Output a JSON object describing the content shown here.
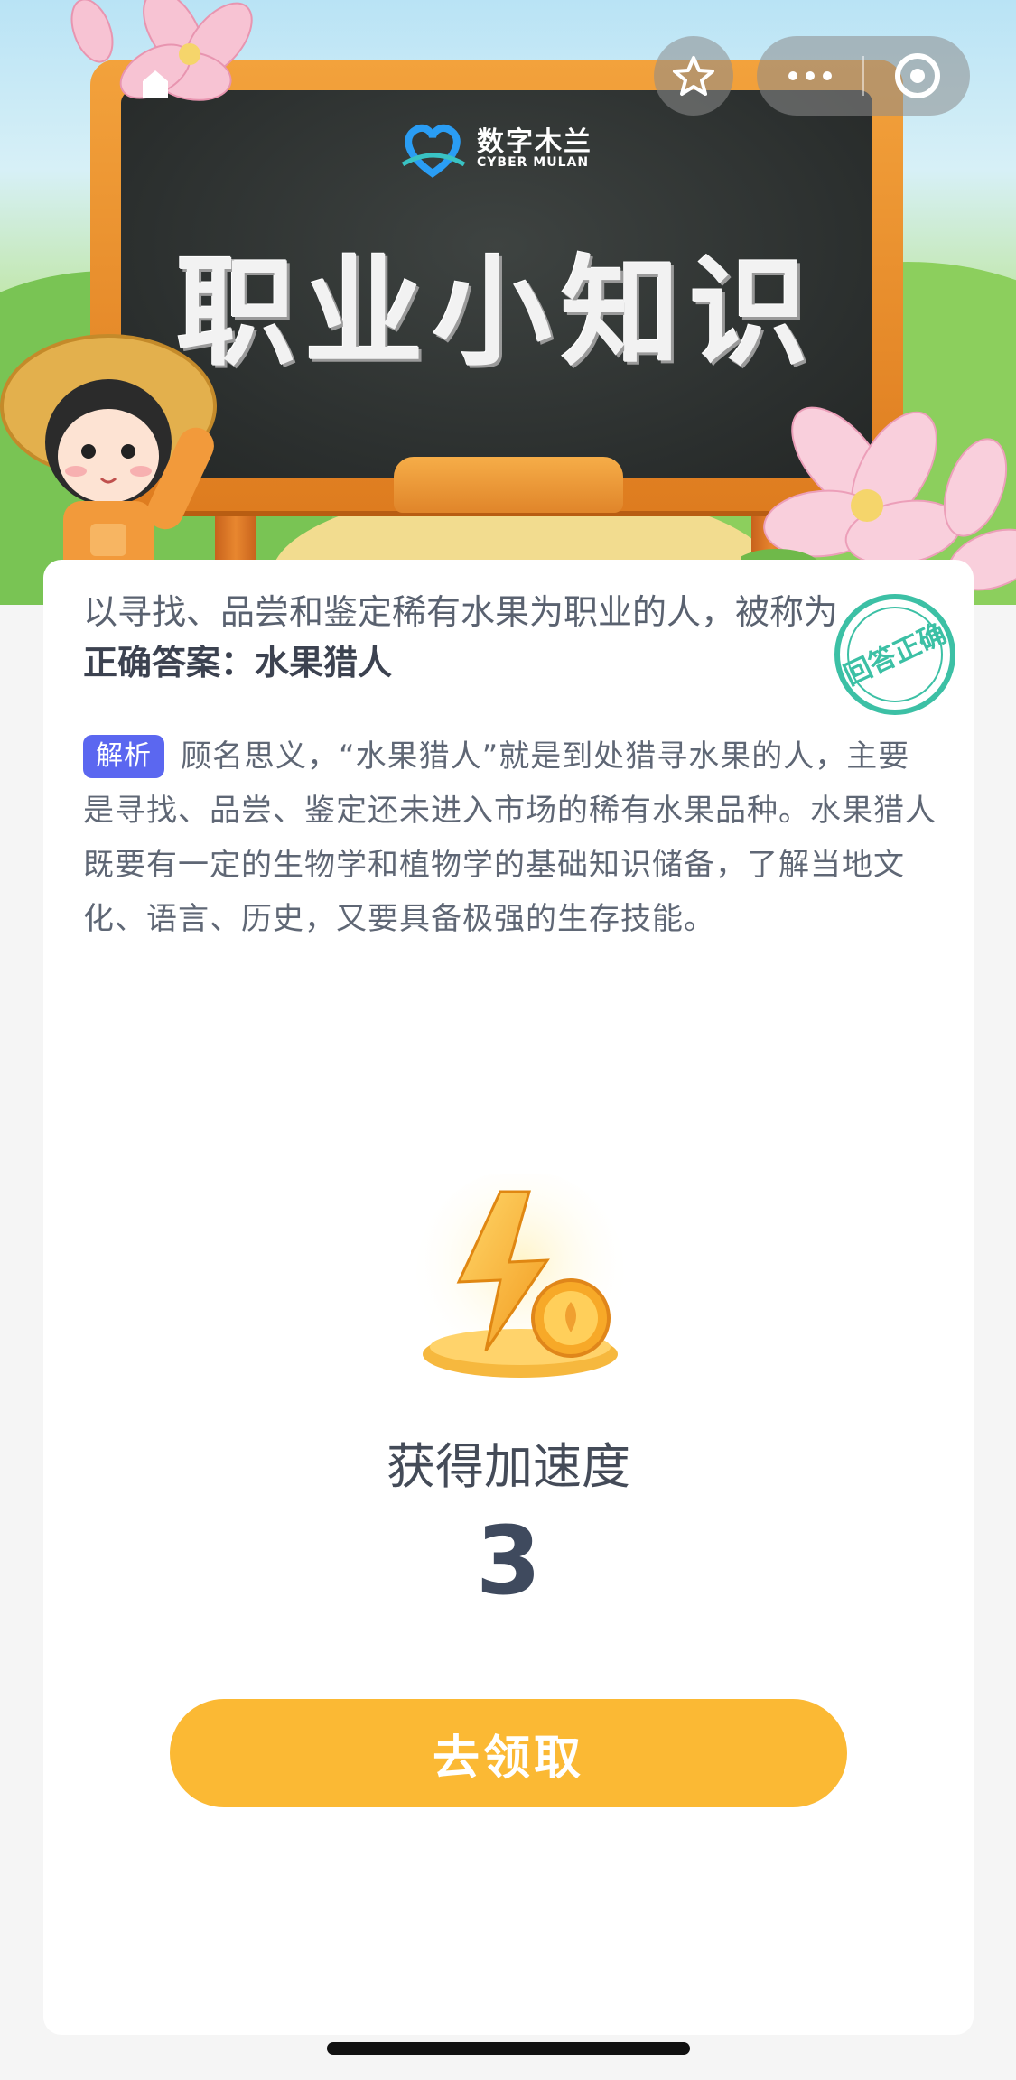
{
  "banner": {
    "logo_cn": "数字木兰",
    "logo_en": "CYBER MULAN",
    "title": "职业小知识"
  },
  "quiz": {
    "question": "以寻找、品尝和鉴定稀有水果为职业的人，被称为",
    "answer": "正确答案：水果猎人",
    "stamp_text": "回答正确",
    "explain_tag": "解析",
    "explanation": "顾名思义，“水果猎人”就是到处猎寻水果的人，主要是寻找、品尝、鉴定还未进入市场的稀有水果品种。水果猎人既要有一定的生物学和植物学的基础知识储备，了解当地文化、语言、历史，又要具备极强的生存技能。"
  },
  "reward": {
    "label": "获得加速度",
    "value": "3",
    "icon": "lightning-coin-icon",
    "button_label": "去领取"
  },
  "colors": {
    "accent": "#fbb934",
    "tag": "#5b67f0",
    "stamp": "#3cc0a5"
  }
}
